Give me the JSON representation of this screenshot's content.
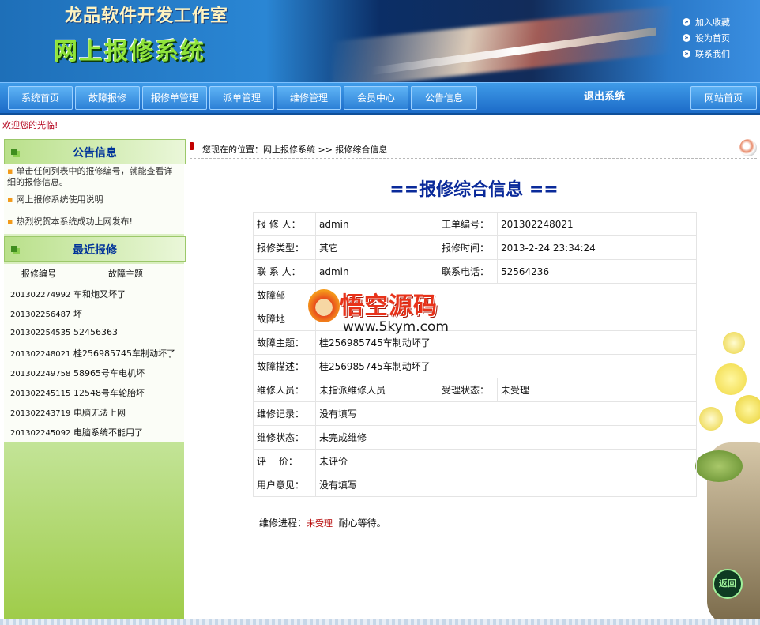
{
  "header": {
    "company": "龙品软件开发工作室",
    "system_name": "网上报修系统",
    "links": [
      "加入收藏",
      "设为首页",
      "联系我们"
    ]
  },
  "nav": {
    "tabs": [
      "系统首页",
      "故障报修",
      "报修单管理",
      "派单管理",
      "维修管理",
      "会员中心",
      "公告信息"
    ],
    "logout": "退出系统",
    "site_home": "网站首页"
  },
  "welcome": "欢迎您的光临!",
  "sidebar": {
    "notice_title": "公告信息",
    "notices": [
      "单击任何列表中的报修编号，就能查看详细的报修信息。",
      "网上报修系统使用说明",
      "热烈祝贺本系统成功上网发布!"
    ],
    "recent_title": "最近报修",
    "recent_headers": [
      "报修编号",
      "故障主题"
    ],
    "recent": [
      {
        "no": "201302274992",
        "topic": "车和炮又坏了"
      },
      {
        "no": "201302256487",
        "topic": "坏"
      },
      {
        "no": "201302254535",
        "topic": "52456363"
      },
      {
        "no": "201302248021",
        "topic": "桂256985745车制动坏了"
      },
      {
        "no": "201302249758",
        "topic": "58965号车电机坏"
      },
      {
        "no": "201302245115",
        "topic": "12548号车轮胎坏"
      },
      {
        "no": "201302243719",
        "topic": "电脑无法上网"
      },
      {
        "no": "201302245092",
        "topic": "电脑系统不能用了"
      }
    ]
  },
  "breadcrumb": "您现在的位置：网上报修系统 >> 报修综合信息",
  "main": {
    "title": "==报修综合信息 ==",
    "rows": {
      "reporter_label": "报 修 人：",
      "reporter": "admin",
      "order_label": "工单编号：",
      "order": "201302248021",
      "type_label": "报修类型：",
      "type": "其它",
      "time_label": "报修时间：",
      "time": "2013-2-24 23:34:24",
      "contact_label": "联 系 人：",
      "contact": "admin",
      "phone_label": "联系电话：",
      "phone": "52564236",
      "dept_label": "故障部",
      "addr_label": "故障地",
      "topic_label": "故障主题：",
      "topic": "桂256985745车制动坏了",
      "desc_label": "故障描述：",
      "desc": "桂256985745车制动坏了",
      "staff_label": "维修人员：",
      "staff": "未指派维修人员",
      "accept_label": "受理状态：",
      "accept": "未受理",
      "record_label": "维修记录：",
      "record": "没有填写",
      "status_label": "维修状态：",
      "status": "未完成维修",
      "eval_label": "评　 价：",
      "eval": "未评价",
      "opinion_label": "用户意见：",
      "opinion": "没有填写"
    },
    "progress_label": "维修进程：",
    "progress_status": "未受理",
    "progress_note": "耐心等待。"
  },
  "watermark": {
    "name": "悟空源码",
    "url": "www.5kym.com"
  },
  "back_button": "返回",
  "colors": {
    "nav_blue": "#2c80d6",
    "sidebar_green": "#9fcc4a",
    "title_blue": "#0a2a9a",
    "alert_red": "#b30000"
  }
}
